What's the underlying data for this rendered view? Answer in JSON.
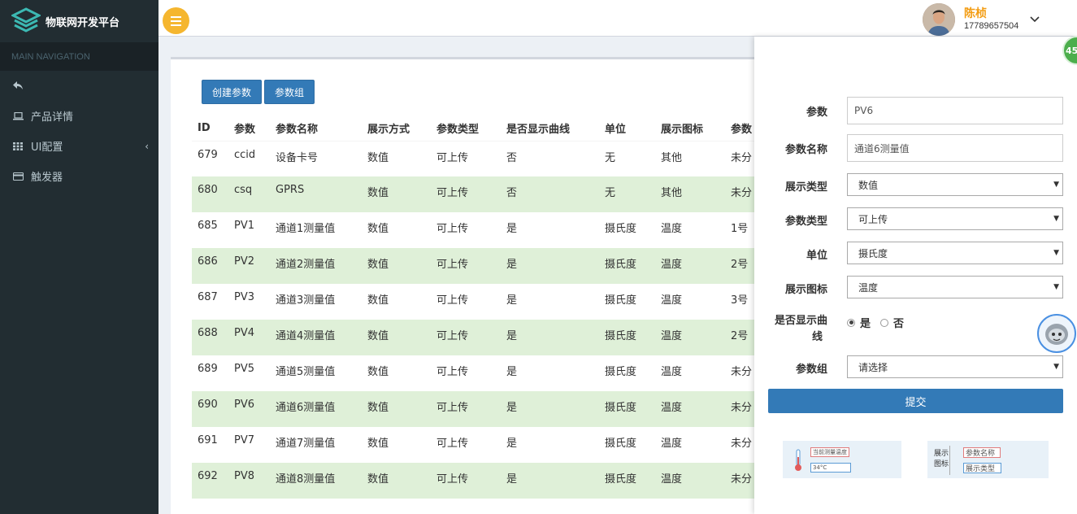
{
  "sidebar": {
    "brand": "物联网开发平台",
    "nav_header": "MAIN NAVIGATION",
    "items": [
      {
        "label": "",
        "icon": "reply-icon"
      },
      {
        "label": "产品详情",
        "icon": "laptop-icon"
      },
      {
        "label": "UI配置",
        "icon": "grid-icon"
      },
      {
        "label": "触发器",
        "icon": "credit-card-icon"
      }
    ]
  },
  "header": {
    "user_name": "陈桢",
    "user_phone": "17789657504"
  },
  "toolbar": {
    "create_label": "创建参数",
    "group_label": "参数组"
  },
  "table": {
    "columns": [
      "ID",
      "参数",
      "参数名称",
      "展示方式",
      "参数类型",
      "是否显示曲线",
      "单位",
      "展示图标",
      "参数"
    ],
    "rows": [
      [
        "679",
        "ccid",
        "设备卡号",
        "数值",
        "可上传",
        "否",
        "无",
        "其他",
        "未分"
      ],
      [
        "680",
        "csq",
        "GPRS",
        "数值",
        "可上传",
        "否",
        "无",
        "其他",
        "未分"
      ],
      [
        "685",
        "PV1",
        "通道1测量值",
        "数值",
        "可上传",
        "是",
        "摄氏度",
        "温度",
        "1号"
      ],
      [
        "686",
        "PV2",
        "通道2测量值",
        "数值",
        "可上传",
        "是",
        "摄氏度",
        "温度",
        "2号"
      ],
      [
        "687",
        "PV3",
        "通道3测量值",
        "数值",
        "可上传",
        "是",
        "摄氏度",
        "温度",
        "3号"
      ],
      [
        "688",
        "PV4",
        "通道4测量值",
        "数值",
        "可上传",
        "是",
        "摄氏度",
        "温度",
        "2号"
      ],
      [
        "689",
        "PV5",
        "通道5测量值",
        "数值",
        "可上传",
        "是",
        "摄氏度",
        "温度",
        "未分"
      ],
      [
        "690",
        "PV6",
        "通道6测量值",
        "数值",
        "可上传",
        "是",
        "摄氏度",
        "温度",
        "未分"
      ],
      [
        "691",
        "PV7",
        "通道7测量值",
        "数值",
        "可上传",
        "是",
        "摄氏度",
        "温度",
        "未分"
      ],
      [
        "692",
        "PV8",
        "通道8测量值",
        "数值",
        "可上传",
        "是",
        "摄氏度",
        "温度",
        "未分"
      ]
    ]
  },
  "form": {
    "param_label": "参数",
    "param_value": "PV6",
    "name_label": "参数名称",
    "name_value": "通道6测量值",
    "display_type_label": "展示类型",
    "display_type_value": "数值",
    "param_type_label": "参数类型",
    "param_type_value": "可上传",
    "unit_label": "单位",
    "unit_value": "摄氏度",
    "icon_label": "展示图标",
    "icon_value": "温度",
    "curve_label_1": "是否显示曲",
    "curve_label_2": "线",
    "curve_yes": "是",
    "curve_no": "否",
    "curve_selected": "是",
    "group_label": "参数组",
    "group_value": "请选择",
    "submit_label": "提交"
  },
  "preview": {
    "left_title": "当前测量温度",
    "left_value": "34°C",
    "right_side_1": "展示",
    "right_side_2": "图标",
    "right_name": "参数名称",
    "right_type": "展示类型"
  },
  "badge": "45"
}
